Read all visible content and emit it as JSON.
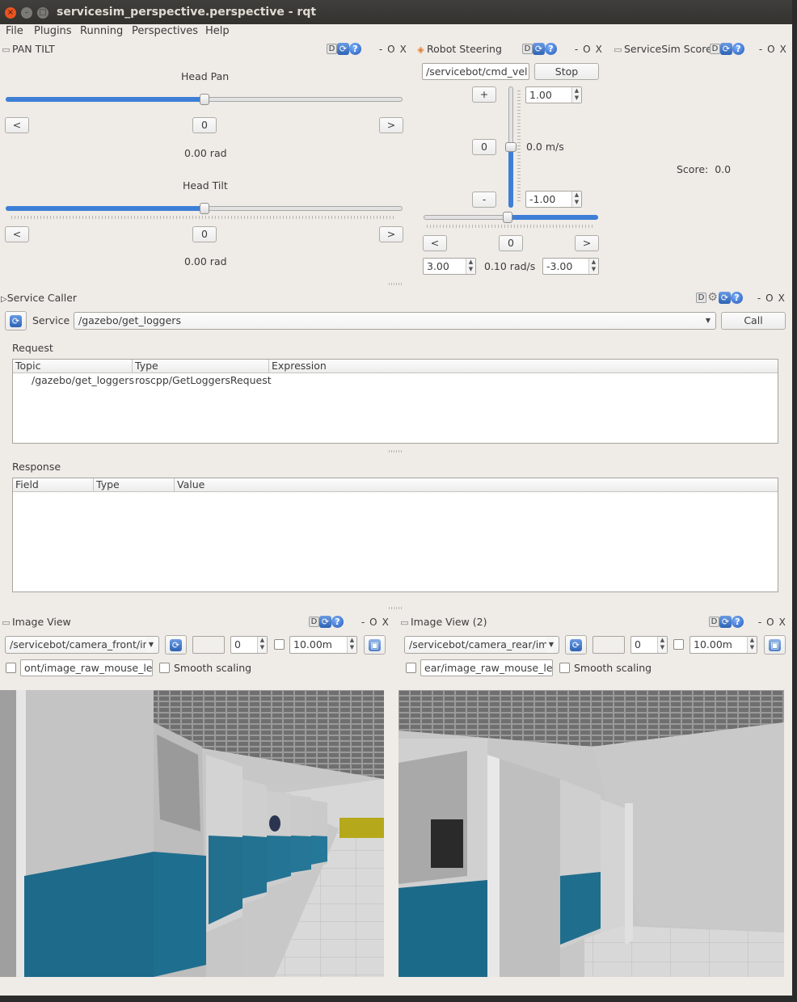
{
  "window": {
    "title": "servicesim_perspective.perspective - rqt",
    "buttons": {
      "close": "×",
      "minimize": "–",
      "maximize": "□"
    }
  },
  "menu": [
    "File",
    "Plugins",
    "Running",
    "Perspectives",
    "Help"
  ],
  "dock_controls": {
    "d": "D",
    "o": "O",
    "x": "X",
    "minus": "-"
  },
  "pan_tilt": {
    "title": "PAN TILT",
    "pan": {
      "label": "Head Pan",
      "value": "0",
      "readout": "0.00 rad",
      "left": "<",
      "right": ">",
      "level": 0.5
    },
    "tilt": {
      "label": "Head Tilt",
      "value": "0",
      "readout": "0.00 rad",
      "left": "<",
      "right": ">",
      "level": 0.5
    }
  },
  "robot_steering": {
    "title": "Robot Steering",
    "topic": "/servicebot/cmd_vel",
    "stop_label": "Stop",
    "plus": "+",
    "minus": "-",
    "linear_zero": "0",
    "linear_max": "1.00",
    "linear_min": "-1.00",
    "linear_readout": "0.0 m/s",
    "angular_left": "<",
    "angular_right": ">",
    "angular_zero": "0",
    "angular_max": "3.00",
    "angular_min": "-3.00",
    "angular_readout": "0.10 rad/s"
  },
  "score": {
    "title": "ServiceSim Score",
    "label": "Score:",
    "value": "0.0"
  },
  "service_caller": {
    "title": "Service Caller",
    "service_label": "Service",
    "service": "/gazebo/get_loggers",
    "call_label": "Call",
    "request_label": "Request",
    "request_columns": [
      "Topic",
      "Type",
      "Expression"
    ],
    "request_rows": [
      {
        "topic": "/gazebo/get_loggers",
        "type": "roscpp/GetLoggersRequest",
        "expression": ""
      }
    ],
    "response_label": "Response",
    "response_columns": [
      "Field",
      "Type",
      "Value"
    ]
  },
  "image_view_1": {
    "title": "Image View",
    "topic": "/servicebot/camera_front/in",
    "blank": "",
    "num": "0",
    "distance": "10.00m",
    "mouse_topic": "ont/image_raw_mouse_left",
    "smooth_label": "Smooth scaling"
  },
  "image_view_2": {
    "title": "Image View (2)",
    "topic": "/servicebot/camera_rear/im",
    "blank": "",
    "num": "0",
    "distance": "10.00m",
    "mouse_topic": "ear/image_raw_mouse_left",
    "smooth_label": "Smooth scaling"
  },
  "colors": {
    "accent": "#3d7fd6",
    "panel_bg": "#efebe7",
    "titlebar": "#3a3935",
    "close": "#e95420"
  }
}
